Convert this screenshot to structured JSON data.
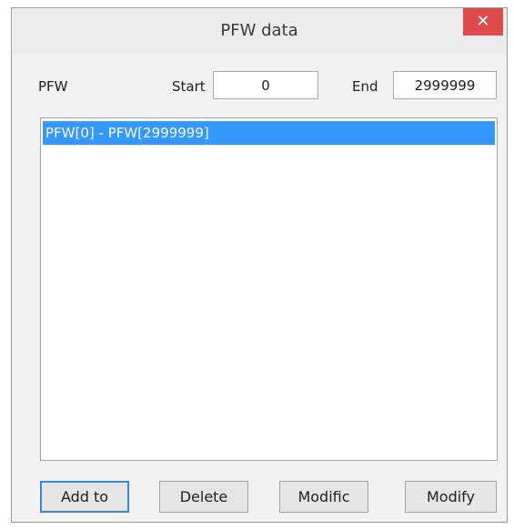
{
  "window": {
    "title": "PFW data",
    "close_glyph": "✕"
  },
  "range": {
    "type_label": "PFW",
    "start_label": "Start",
    "start_value": "0",
    "end_label": "End",
    "end_value": "2999999"
  },
  "list": {
    "items": [
      {
        "label": "PFW[0] - PFW[2999999]",
        "selected": true
      }
    ]
  },
  "buttons": {
    "add_to": "Add to",
    "delete": "Delete",
    "modific": "Modific",
    "modify": "Modify"
  },
  "colors": {
    "selection": "#3399ff",
    "close_button": "#e04a4a"
  }
}
